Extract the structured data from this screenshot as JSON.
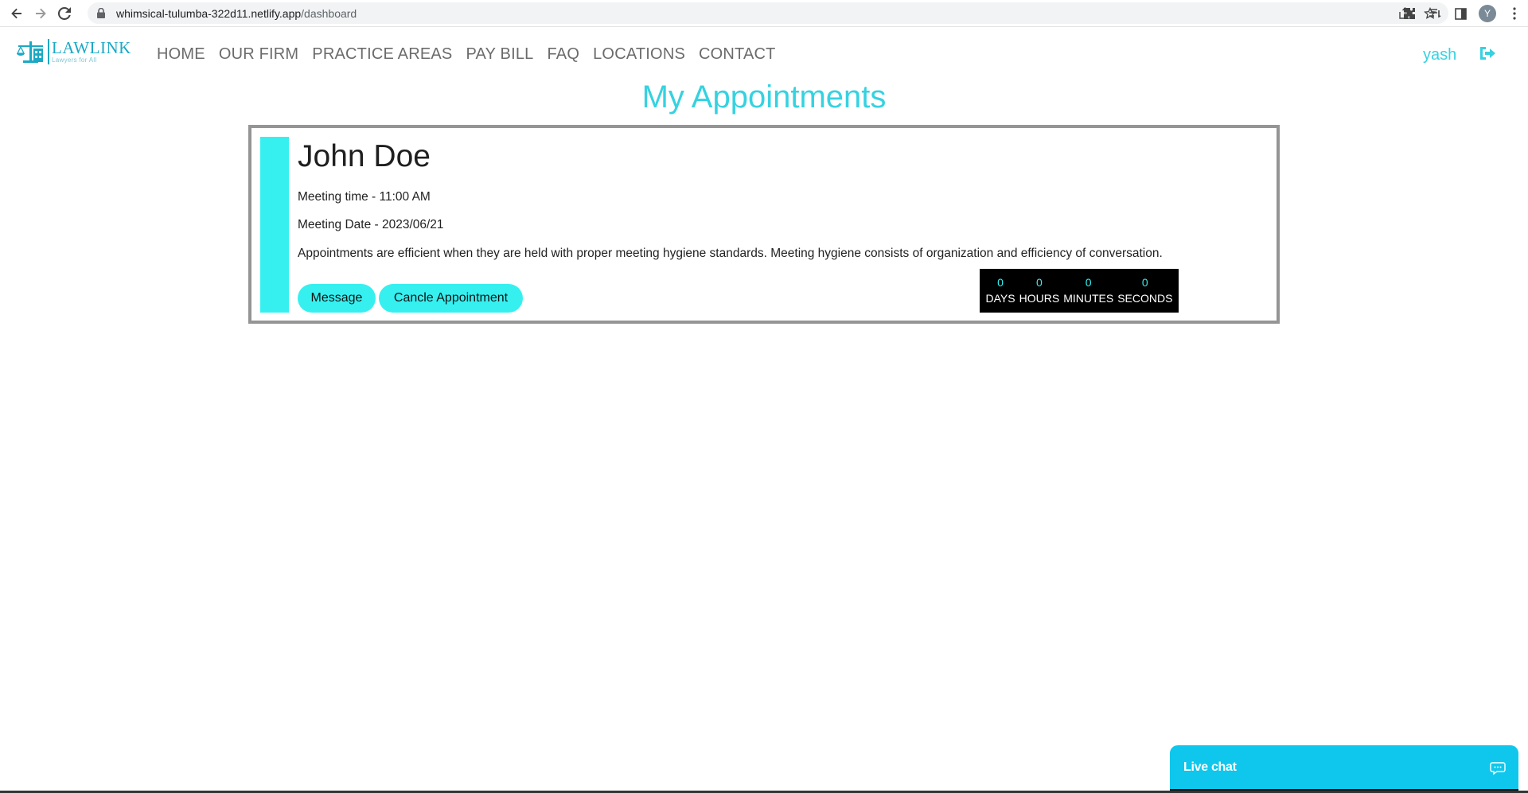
{
  "browser": {
    "url_host": "whimsical-tulumba-322d11.netlify.app",
    "url_path": "/dashboard",
    "profile_initial": "Y"
  },
  "site": {
    "logo_word": "LAWLINK",
    "logo_tagline": "Lawyers for All",
    "nav": [
      "HOME",
      "OUR FIRM",
      "PRACTICE AREAS",
      "PAY BILL",
      "FAQ",
      "LOCATIONS",
      "CONTACT"
    ],
    "user_name": "yash",
    "accent_color": "#36d2e0"
  },
  "page": {
    "title": "My Appointments"
  },
  "appointment": {
    "client_name": "John Doe",
    "meeting_time": "Meeting time - 11:00 AM",
    "meeting_date": "Meeting Date - 2023/06/21",
    "description": "Appointments are efficient when they are held with proper meeting hygiene standards. Meeting hygiene consists of organization and efficiency of conversation.",
    "message_label": "Message",
    "cancel_label": "Cancle Appointment",
    "countdown": [
      {
        "value": "0",
        "label": "DAYS"
      },
      {
        "value": "0",
        "label": "HOURS"
      },
      {
        "value": "0",
        "label": "MINUTES"
      },
      {
        "value": "0",
        "label": "SECONDS"
      }
    ]
  },
  "chat": {
    "label": "Live chat"
  },
  "icons": {
    "back": "arrow-left-icon",
    "forward": "arrow-right-icon",
    "reload": "reload-icon",
    "lock": "lock-icon",
    "share": "share-icon",
    "star": "star-icon",
    "extensions": "puzzle-icon",
    "reading_list": "reading-list-icon",
    "sidebar": "sidebar-icon",
    "menu": "kebab-menu-icon",
    "logout": "logout-icon",
    "chat": "chat-bubble-icon"
  }
}
